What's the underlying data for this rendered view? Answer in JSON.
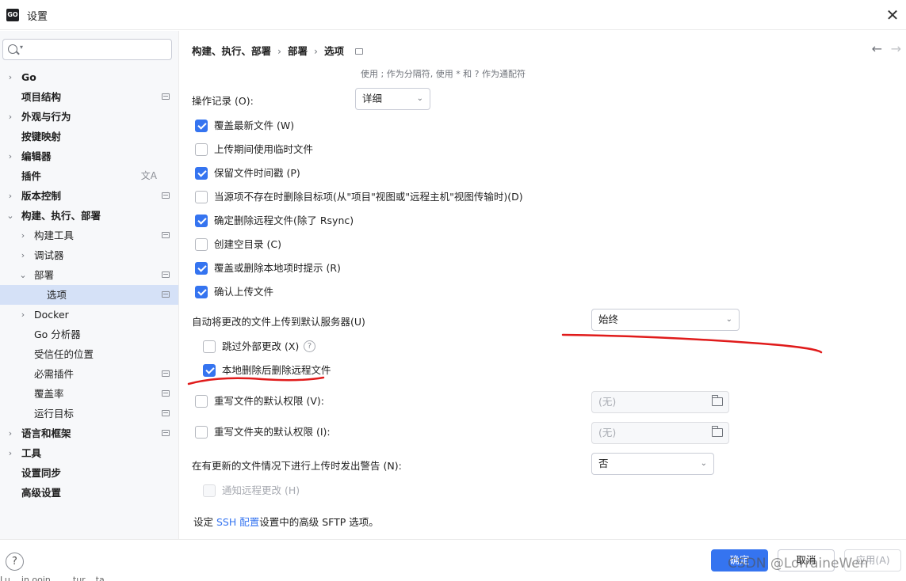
{
  "window": {
    "logo_text": "GO",
    "title": "设置",
    "close_glyph": "✕"
  },
  "sidebar": {
    "search_placeholder": "",
    "items": [
      {
        "label": "Go",
        "expander": "›",
        "bold": true
      },
      {
        "label": "项目结构",
        "bold": true
      },
      {
        "label": "外观与行为",
        "expander": "›",
        "bold": true
      },
      {
        "label": "按键映射",
        "bold": true
      },
      {
        "label": "编辑器",
        "expander": "›",
        "bold": true
      },
      {
        "label": "插件",
        "bold": true
      },
      {
        "label": "版本控制",
        "expander": "›",
        "bold": true
      },
      {
        "label": "构建、执行、部署",
        "expander": "⌄",
        "bold": true
      },
      {
        "label": "构建工具",
        "expander": "›"
      },
      {
        "label": "调试器",
        "expander": "›"
      },
      {
        "label": "部署",
        "expander": "⌄"
      },
      {
        "label": "选项",
        "selected": true
      },
      {
        "label": "Docker",
        "expander": "›"
      },
      {
        "label": "Go 分析器"
      },
      {
        "label": "受信任的位置"
      },
      {
        "label": "必需插件"
      },
      {
        "label": "覆盖率"
      },
      {
        "label": "运行目标"
      },
      {
        "label": "语言和框架",
        "expander": "›",
        "bold": true
      },
      {
        "label": "工具",
        "expander": "›",
        "bold": true
      },
      {
        "label": "设置同步",
        "bold": true
      },
      {
        "label": "高级设置",
        "bold": true
      }
    ]
  },
  "breadcrumb": {
    "part1": "构建、执行、部署",
    "part2": "部署",
    "part3": "选项",
    "sep": "›"
  },
  "nav": {
    "back": "←",
    "forward": "→"
  },
  "hint": "使用 ; 作为分隔符, 使用 * 和 ? 作为通配符",
  "settings": {
    "operation_log": {
      "label": "操作记录 (O):",
      "value": "详细"
    },
    "checkboxes": [
      {
        "label": "覆盖最新文件 (W)",
        "checked": true
      },
      {
        "label": "上传期间使用临时文件",
        "checked": false
      },
      {
        "label": "保留文件时间戳 (P)",
        "checked": true
      },
      {
        "label": "当源项不存在时删除目标项(从\"项目\"视图或\"远程主机\"视图传输时)(D)",
        "checked": false
      },
      {
        "label": "确定删除远程文件(除了 Rsync)",
        "checked": true
      },
      {
        "label": "创建空目录 (C)",
        "checked": false
      },
      {
        "label": "覆盖或删除本地项时提示 (R)",
        "checked": true
      },
      {
        "label": "确认上传文件",
        "checked": true
      }
    ],
    "auto_upload": {
      "label": "自动将更改的文件上传到默认服务器(U)",
      "value": "始终"
    },
    "skip_external": {
      "label": "跳过外部更改 (X)",
      "checked": false,
      "help": "?"
    },
    "delete_remote": {
      "label": "本地删除后删除远程文件",
      "checked": true
    },
    "file_perms": {
      "label": "重写文件的默认权限 (V):",
      "checked": false,
      "placeholder": "(无)"
    },
    "folder_perms": {
      "label": "重写文件夹的默认权限 (I):",
      "checked": false,
      "placeholder": "(无)"
    },
    "warn_newer": {
      "label": "在有更新的文件情况下进行上传时发出警告 (N):",
      "value": "否"
    },
    "notify_remote": {
      "label": "通知远程更改 (H)",
      "checked": false,
      "disabled": true
    }
  },
  "footer_note": {
    "prefix": "设定 ",
    "link": "SSH 配置",
    "suffix": "设置中的高级 SFTP 选项。"
  },
  "buttons": {
    "help": "?",
    "ok": "确定",
    "cancel": "取消",
    "apply": "应用(A)"
  },
  "watermark": "CSDN @LorraineWen",
  "cut_text": "Lu... in ooin... ... tur... ta...",
  "colors": {
    "accent": "#3574f0",
    "selection": "#d5e1f7",
    "annotation": "#e01b1b"
  }
}
